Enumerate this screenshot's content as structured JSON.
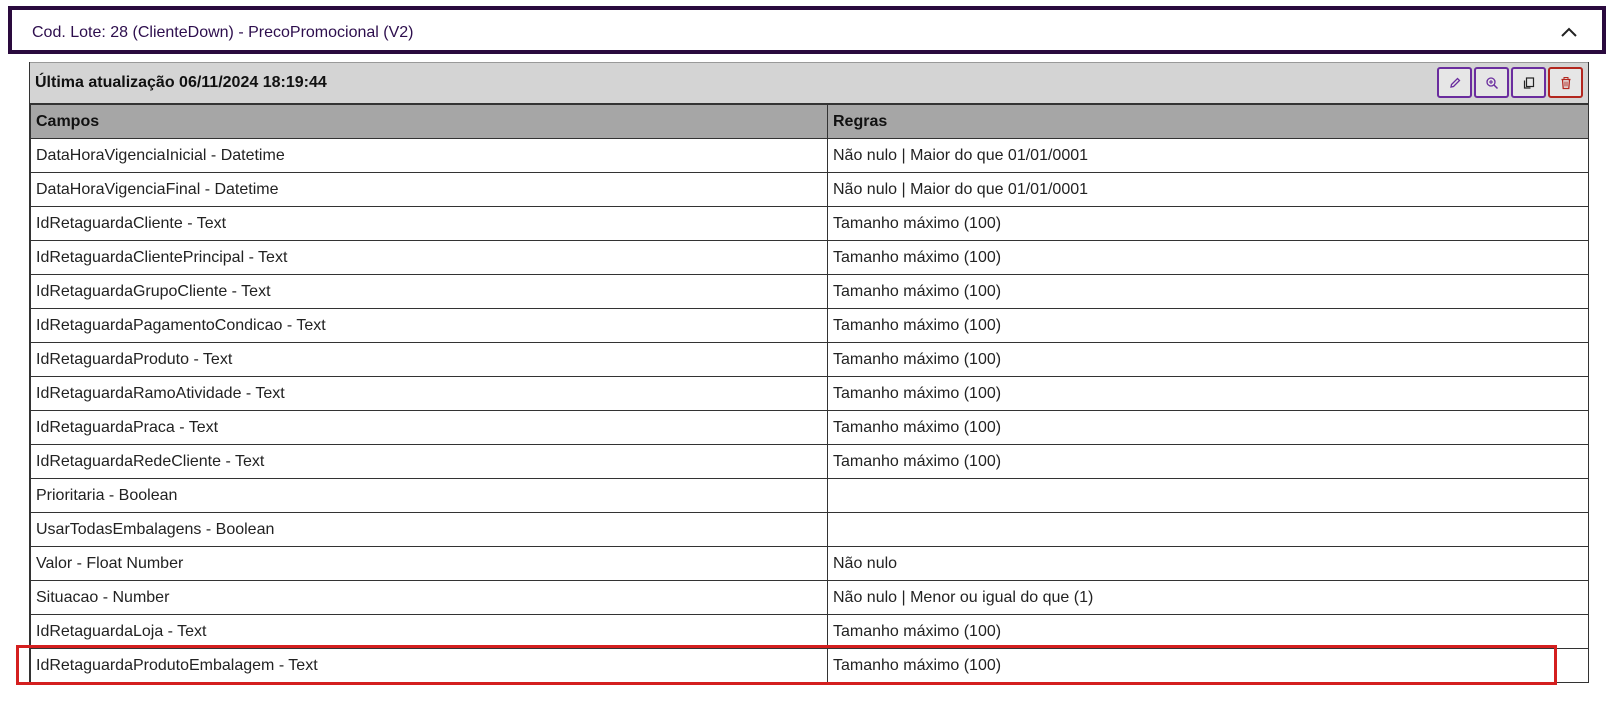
{
  "accordion": {
    "title": "Cod. Lote: 28 (ClienteDown) - PrecoPromocional (V2)",
    "toggle_icon": "chevron-up-icon"
  },
  "panel": {
    "title": "Última atualização 06/11/2024 18:19:44",
    "actions": [
      {
        "name": "edit",
        "icon": "pencil-icon"
      },
      {
        "name": "view",
        "icon": "zoom-in-icon"
      },
      {
        "name": "copy",
        "icon": "copy-icon"
      },
      {
        "name": "delete",
        "icon": "trash-icon"
      }
    ]
  },
  "table": {
    "headers": [
      "Campos",
      "Regras"
    ],
    "rows": [
      {
        "campo": "DataHoraVigenciaInicial - Datetime",
        "regra": "Não nulo | Maior do que 01/01/0001"
      },
      {
        "campo": "DataHoraVigenciaFinal - Datetime",
        "regra": "Não nulo | Maior do que 01/01/0001"
      },
      {
        "campo": "IdRetaguardaCliente - Text",
        "regra": "Tamanho máximo (100)"
      },
      {
        "campo": "IdRetaguardaClientePrincipal - Text",
        "regra": "Tamanho máximo (100)"
      },
      {
        "campo": "IdRetaguardaGrupoCliente - Text",
        "regra": "Tamanho máximo (100)"
      },
      {
        "campo": "IdRetaguardaPagamentoCondicao - Text",
        "regra": "Tamanho máximo (100)"
      },
      {
        "campo": "IdRetaguardaProduto - Text",
        "regra": "Tamanho máximo (100)"
      },
      {
        "campo": "IdRetaguardaRamoAtividade - Text",
        "regra": "Tamanho máximo (100)"
      },
      {
        "campo": "IdRetaguardaPraca - Text",
        "regra": "Tamanho máximo (100)"
      },
      {
        "campo": "IdRetaguardaRedeCliente - Text",
        "regra": "Tamanho máximo (100)"
      },
      {
        "campo": "Prioritaria - Boolean",
        "regra": ""
      },
      {
        "campo": "UsarTodasEmbalagens - Boolean",
        "regra": ""
      },
      {
        "campo": "Valor - Float Number",
        "regra": "Não nulo"
      },
      {
        "campo": "Situacao - Number",
        "regra": "Não nulo | Menor ou igual do que (1)"
      },
      {
        "campo": "IdRetaguardaLoja - Text",
        "regra": "Tamanho máximo (100)"
      },
      {
        "campo": "IdRetaguardaProdutoEmbalagem - Text",
        "regra": "Tamanho máximo (100)"
      }
    ]
  },
  "colors": {
    "accent": "#6a2c9e",
    "header_border": "#2a0a3e",
    "danger": "#b3261e",
    "highlight": "#d41f1f"
  }
}
